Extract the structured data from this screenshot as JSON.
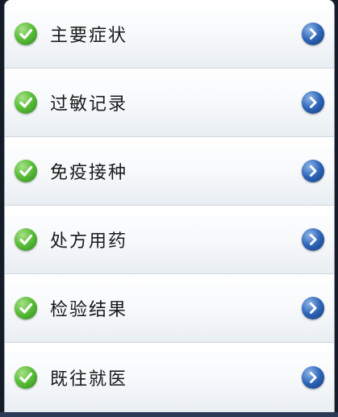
{
  "menu": {
    "items": [
      {
        "label": "主要症状",
        "check_icon": "check-circle-icon",
        "arrow_icon": "chevron-right-circle-icon"
      },
      {
        "label": "过敏记录",
        "check_icon": "check-circle-icon",
        "arrow_icon": "chevron-right-circle-icon"
      },
      {
        "label": "免疫接种",
        "check_icon": "check-circle-icon",
        "arrow_icon": "chevron-right-circle-icon"
      },
      {
        "label": "处方用药",
        "check_icon": "check-circle-icon",
        "arrow_icon": "chevron-right-circle-icon"
      },
      {
        "label": "检验结果",
        "check_icon": "check-circle-icon",
        "arrow_icon": "chevron-right-circle-icon"
      },
      {
        "label": "既往就医",
        "check_icon": "check-circle-icon",
        "arrow_icon": "chevron-right-circle-icon"
      }
    ]
  },
  "colors": {
    "check_green": "#4caf2e",
    "arrow_blue": "#2d64b8",
    "text": "#1a1a1a",
    "divider": "#cfd6de"
  }
}
